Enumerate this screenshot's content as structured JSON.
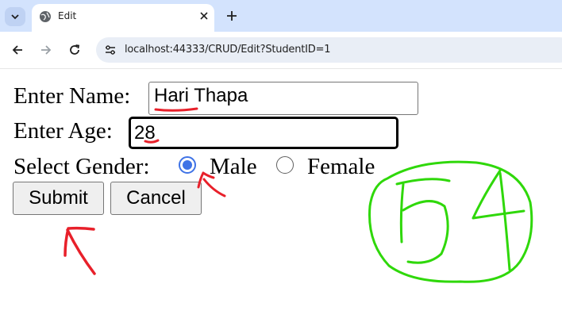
{
  "browser": {
    "tab_title": "Edit",
    "url": "localhost:44333/CRUD/Edit?StudentID=1"
  },
  "form": {
    "name_label": "Enter Name:",
    "name_value": "Hari Thapa",
    "age_label": "Enter Age:",
    "age_value": "28",
    "gender_label": "Select Gender:",
    "gender_options": [
      {
        "label": "Male",
        "checked": true
      },
      {
        "label": "Female",
        "checked": false
      }
    ],
    "submit_label": "Submit",
    "cancel_label": "Cancel"
  },
  "annotations": {
    "handwritten_number": "54",
    "ink_colors": {
      "red": "#e8202a",
      "green": "#2fd80a"
    }
  },
  "colors": {
    "tabstrip_bg": "#d3e3fd",
    "omnibox_bg": "#e9eef6",
    "radio_accent": "#3f73e6"
  }
}
